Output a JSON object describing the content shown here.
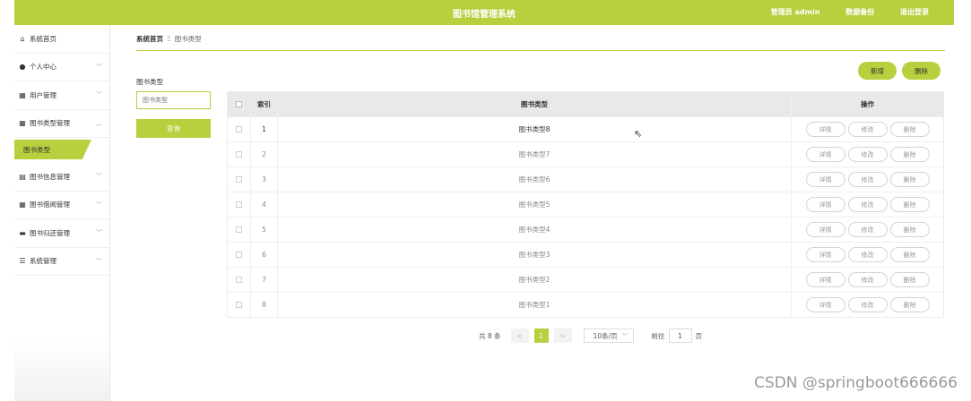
{
  "header": {
    "title": "图书馆管理系统",
    "user": "管理员 admin",
    "backup": "数据备份",
    "logout": "退出登录"
  },
  "sidebar": {
    "items": [
      {
        "icon": "home-icon",
        "glyph": "⌂",
        "label": "系统首页",
        "chevron": ""
      },
      {
        "icon": "user-icon",
        "glyph": "●",
        "label": "个人中心",
        "chevron": "﹀"
      },
      {
        "icon": "grid-icon",
        "glyph": "▦",
        "label": "用户管理",
        "chevron": "﹀"
      },
      {
        "icon": "grid-icon",
        "glyph": "▦",
        "label": "图书类型管理",
        "chevron": "︿"
      },
      {
        "icon": "clipboard-icon",
        "glyph": "▤",
        "label": "图书信息管理",
        "chevron": "﹀"
      },
      {
        "icon": "grid-icon",
        "glyph": "▦",
        "label": "图书借阅管理",
        "chevron": "﹀"
      },
      {
        "icon": "briefcase-icon",
        "glyph": "▬",
        "label": "图书归还管理",
        "chevron": "﹀"
      },
      {
        "icon": "list-icon",
        "glyph": "☰",
        "label": "系统管理",
        "chevron": "﹀"
      }
    ],
    "submenu": {
      "label": "图书类型"
    }
  },
  "breadcrumb": {
    "home": "系统首页",
    "sep": "Ξ",
    "current": "图书类型"
  },
  "filter": {
    "label": "图书类型",
    "placeholder": "图书类型",
    "search_label": "查询"
  },
  "actions": {
    "add": "新增",
    "delete": "删除"
  },
  "table": {
    "headers": {
      "index": "索引",
      "type": "图书类型",
      "ops": "操作"
    },
    "rows": [
      {
        "index": "1",
        "type": "图书类型8"
      },
      {
        "index": "2",
        "type": "图书类型7"
      },
      {
        "index": "3",
        "type": "图书类型6"
      },
      {
        "index": "4",
        "type": "图书类型5"
      },
      {
        "index": "5",
        "type": "图书类型4"
      },
      {
        "index": "6",
        "type": "图书类型3"
      },
      {
        "index": "7",
        "type": "图书类型2"
      },
      {
        "index": "8",
        "type": "图书类型1"
      }
    ],
    "ops": {
      "detail": "详情",
      "edit": "修改",
      "delete": "删除"
    }
  },
  "pagination": {
    "total": "共 8 条",
    "prev": "<",
    "page": "1",
    "next": ">",
    "page_size": "10条/页",
    "goto": "前往",
    "goto_value": "1",
    "page_unit": "页"
  },
  "watermark": "CSDN @springboot666666",
  "colors": {
    "accent": "#b6d03e"
  }
}
